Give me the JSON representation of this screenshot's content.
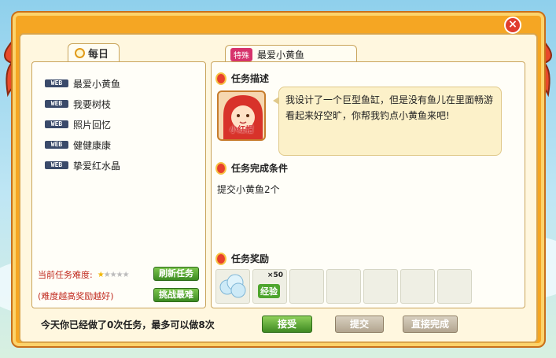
{
  "window": {
    "close_symbol": "×"
  },
  "left": {
    "tab_label": "每日",
    "tab_icon": "clock-icon",
    "quests": [
      {
        "tag": "WEB",
        "label": "最爱小黄鱼"
      },
      {
        "tag": "WEB",
        "label": "我要树枝"
      },
      {
        "tag": "WEB",
        "label": "照片回忆"
      },
      {
        "tag": "WEB",
        "label": "健健康康"
      },
      {
        "tag": "WEB",
        "label": "挚爱红水晶"
      }
    ],
    "difficulty_label": "当前任务难度:",
    "difficulty_stars": 1,
    "difficulty_max": 5,
    "refresh_button": "刷新任务",
    "hint": "(难度越高奖励越好)",
    "challenge_button": "挑战最难"
  },
  "right": {
    "special_badge": "特殊",
    "tab_title": "最爱小黄鱼",
    "description_title": "任务描述",
    "npc_name": "小红帽",
    "description": "我设计了一个巨型鱼缸，但是没有鱼儿在里面畅游看起来好空旷，你帮我钓点小黄鱼来吧!",
    "condition_title": "任务完成条件",
    "condition": "提交小黄鱼2个",
    "reward_title": "任务奖励",
    "rewards": [
      {
        "icon": "cloud-item-icon"
      },
      {
        "icon": "experience-icon",
        "label": "经验",
        "count": "×50"
      }
    ],
    "empty_slots": 5
  },
  "footer": {
    "daily_status": "今天你已经做了0次任务，最多可以做8次",
    "accept_button": "接受",
    "submit_button": "提交",
    "complete_button": "直接完成"
  },
  "colors": {
    "frame": "#f5a623",
    "accent_red": "#c0291e",
    "green_button": "#3c8b22"
  }
}
